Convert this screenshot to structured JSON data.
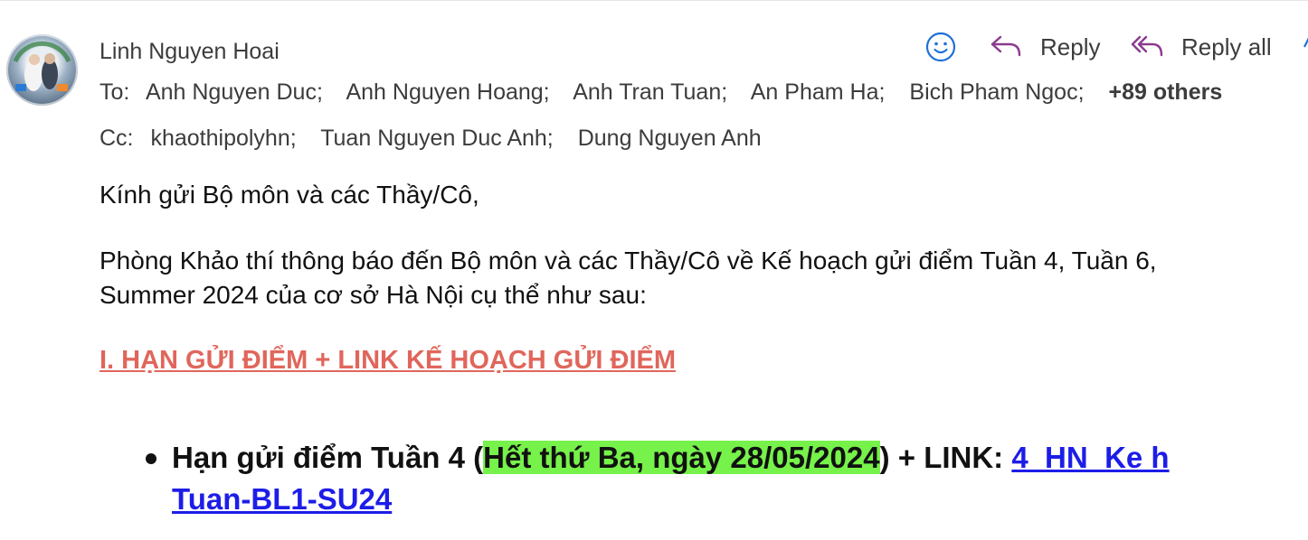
{
  "sender": {
    "name": "Linh Nguyen Hoai"
  },
  "actions": {
    "react_icon": "smiley-icon",
    "reply_label": "Reply",
    "reply_all_label": "Reply all"
  },
  "to": {
    "label": "To:",
    "recipients": [
      "Anh Nguyen Duc;",
      "Anh Nguyen Hoang;",
      "Anh Tran Tuan;",
      "An Pham Ha;",
      "Bich Pham Ngoc;"
    ],
    "more": "+89 others"
  },
  "cc": {
    "label": "Cc:",
    "recipients": [
      "khaothipolyhn;",
      "Tuan Nguyen Duc Anh;",
      "Dung Nguyen Anh"
    ]
  },
  "body": {
    "greeting": "Kính gửi Bộ môn và các Thầy/Cô,",
    "para_line1": "Phòng Khảo thí thông báo đến Bộ môn và các Thầy/Cô về Kế hoạch gửi điểm Tuần 4, Tuần 6,",
    "para_line2": "Summer 2024 của cơ sở Hà Nội cụ thể như sau:",
    "section_heading": "I. HẠN GỬI ĐIỂM + LINK KẾ HOẠCH GỬI ĐIỂM",
    "bullet1": {
      "prefix": "Hạn gửi điểm Tuần 4 (",
      "highlight": "Hết thứ Ba, ngày 28/05/2024",
      "suffix": ") + LINK: ",
      "link_line1": "4_HN_Ke h",
      "link_line2": "Tuan-BL1-SU24"
    }
  },
  "colors": {
    "heading": "#e0665b",
    "highlight": "#76f24a",
    "link": "#1d1de8",
    "reply_icon": "#8b3a8f",
    "react_icon": "#1e6fd9"
  }
}
